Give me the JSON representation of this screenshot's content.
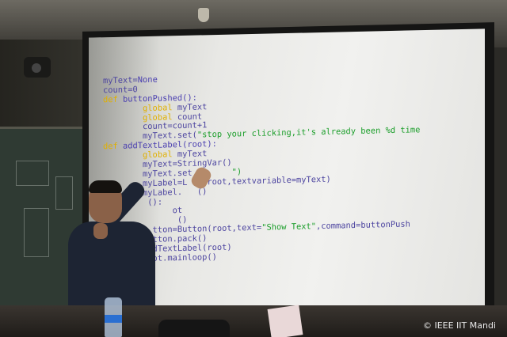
{
  "slide": {
    "code_lines": [
      [
        {
          "t": "myText=",
          "c": "txt"
        },
        {
          "t": "None",
          "c": "fn"
        }
      ],
      [
        {
          "t": "count=0",
          "c": "txt"
        }
      ],
      [
        {
          "t": "def ",
          "c": "kw"
        },
        {
          "t": "buttonPushed():",
          "c": "fn"
        }
      ],
      [
        {
          "t": "        ",
          "c": "txt"
        },
        {
          "t": "global",
          "c": "kw"
        },
        {
          "t": " myText",
          "c": "txt"
        }
      ],
      [
        {
          "t": "        ",
          "c": "txt"
        },
        {
          "t": "global",
          "c": "kw"
        },
        {
          "t": " count",
          "c": "txt"
        }
      ],
      [
        {
          "t": "        count=count+1",
          "c": "txt"
        }
      ],
      [
        {
          "t": "        myText.set(",
          "c": "txt"
        },
        {
          "t": "\"stop your clicking,it's already been %d time",
          "c": "str"
        }
      ],
      [
        {
          "t": "def ",
          "c": "kw"
        },
        {
          "t": "addTextLabel(root):",
          "c": "fn"
        }
      ],
      [
        {
          "t": "        ",
          "c": "txt"
        },
        {
          "t": "global",
          "c": "kw"
        },
        {
          "t": " myText",
          "c": "txt"
        }
      ],
      [
        {
          "t": "        myText=StringVar()",
          "c": "txt"
        }
      ],
      [
        {
          "t": "        myText.set",
          "c": "txt"
        },
        {
          "t": "        \")",
          "c": "str"
        }
      ],
      [
        {
          "t": "        myLabel=L",
          "c": "txt"
        },
        {
          "t": "   (root,textvariable=myText)",
          "c": "txt"
        }
      ],
      [
        {
          "t": "        myLabel.",
          "c": "txt"
        },
        {
          "t": "   ()",
          "c": "txt"
        }
      ],
      [
        {
          "t": "         ():",
          "c": "txt"
        }
      ],
      [
        {
          "t": "              ot",
          "c": "txt"
        }
      ],
      [
        {
          "t": "               ()",
          "c": "txt"
        }
      ],
      [
        {
          "t": "          tton=Button(root,text=",
          "c": "txt"
        },
        {
          "t": "\"Show Text\"",
          "c": "str"
        },
        {
          "t": ",command=buttonPush",
          "c": "txt"
        }
      ],
      [
        {
          "t": "          tton.pack()",
          "c": "txt"
        }
      ],
      [
        {
          "t": "          dTextLabel(root)",
          "c": "txt"
        }
      ],
      [
        {
          "t": "          ot.mainloop()",
          "c": "txt"
        }
      ]
    ]
  },
  "watermark": "© IEEE IIT Mandi"
}
